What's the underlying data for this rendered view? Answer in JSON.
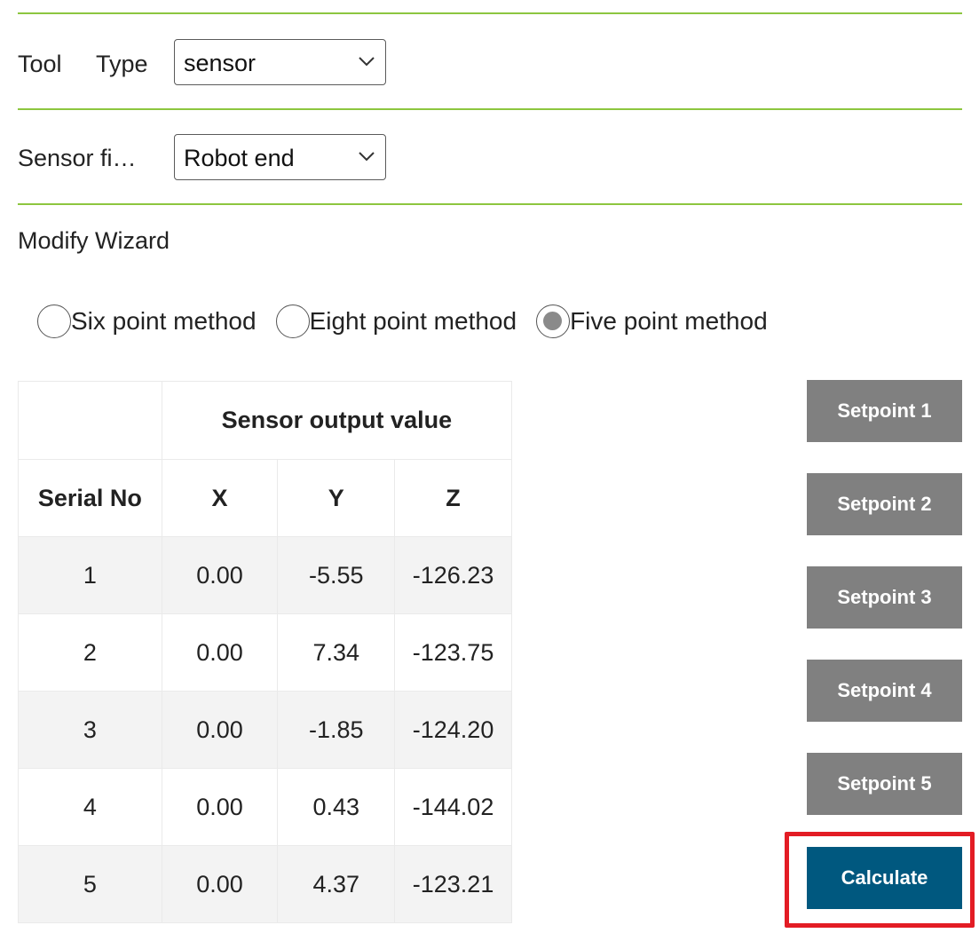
{
  "tool_type": {
    "label_tool": "Tool",
    "label_type": "Type",
    "value": "sensor"
  },
  "sensor_fixing": {
    "label": "Sensor fi…",
    "value": "Robot end"
  },
  "wizard": {
    "title": "Modify Wizard",
    "methods": [
      {
        "label": "Six point method",
        "checked": false
      },
      {
        "label": "Eight point method",
        "checked": false
      },
      {
        "label": "Five point method",
        "checked": true
      }
    ]
  },
  "table": {
    "group_header": "Sensor output value",
    "headers": {
      "serial": "Serial No",
      "x": "X",
      "y": "Y",
      "z": "Z"
    },
    "rows": [
      {
        "serial": "1",
        "x": "0.00",
        "y": "-5.55",
        "z": "-126.23"
      },
      {
        "serial": "2",
        "x": "0.00",
        "y": "7.34",
        "z": "-123.75"
      },
      {
        "serial": "3",
        "x": "0.00",
        "y": "-1.85",
        "z": "-124.20"
      },
      {
        "serial": "4",
        "x": "0.00",
        "y": "0.43",
        "z": "-144.02"
      },
      {
        "serial": "5",
        "x": "0.00",
        "y": "4.37",
        "z": "-123.21"
      }
    ]
  },
  "buttons": {
    "setpoints": [
      "Setpoint 1",
      "Setpoint 2",
      "Setpoint 3",
      "Setpoint 4",
      "Setpoint 5"
    ],
    "calculate": "Calculate"
  },
  "colors": {
    "divider": "#8dc63f",
    "setpoint_button": "#808080",
    "calculate_button": "#00587f",
    "highlight": "#e31c24"
  },
  "icons": {
    "dropdown": "chevron-down-icon"
  }
}
